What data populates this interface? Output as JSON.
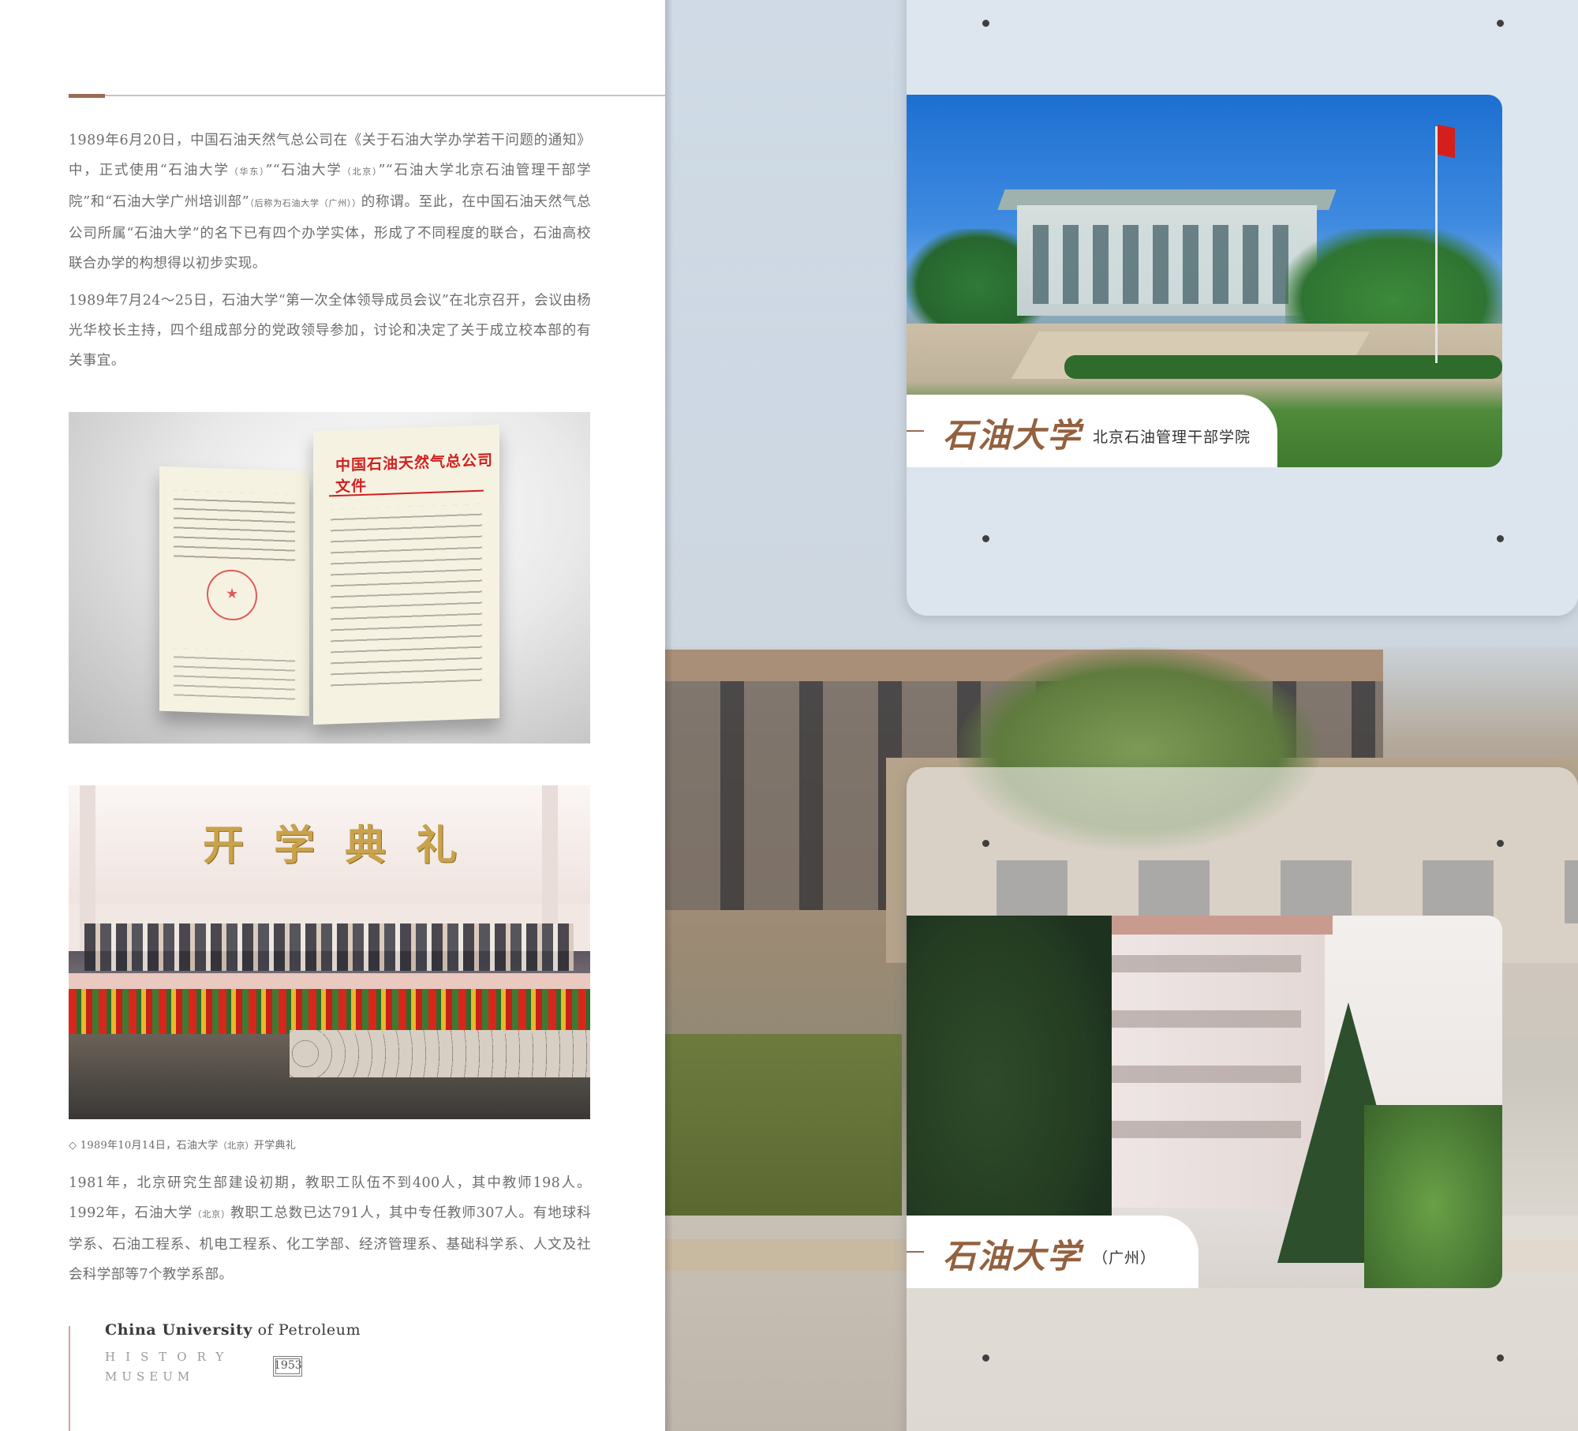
{
  "left_page": {
    "paragraph_1": {
      "text_a": "1989年6月20日，中国石油天然气总公司在《关于石油大学办学若干问题的通知》中，正式使用“石油大学",
      "small_a": "（华东）",
      "text_b": "”“石油大学",
      "small_b": "（北京）",
      "text_c": "”“石油大学北京石油管理干部学院”和“石油大学广州培训部”",
      "small_c": "（后称为石油大学（广州））",
      "text_d": "的称谓。至此，在中国石油天然气总公司所属“石油大学”的名下已有四个办学实体，形成了不同程度的联合，石油高校联合办学的构想得以初步实现。"
    },
    "paragraph_2": "1989年7月24～25日，石油大学“第一次全体领导成员会议”在北京召开，会议由杨光华校长主持，四个组成部分的党政领导参加，讨论和决定了关于成立校本部的有关事宜。",
    "document_photo": {
      "heading": "中国石油天然气总公司文件"
    },
    "ceremony_photo": {
      "banner": "开学典礼"
    },
    "caption": {
      "marker": "◇",
      "text_a": "1989年10月14日，石油大学",
      "small": "（北京）",
      "text_b": "开学典礼"
    },
    "paragraph_3": {
      "text_a": "1981年，北京研究生部建设初期，教职工队伍不到400人，其中教师198人。1992年，石油大学",
      "small": "（北京）",
      "text_b": "教职工总数已达791人，其中专任教师307人。有地球科学系、石油工程系、机电工程系、化工学部、经济管理系、基础科学系、人文及社会科学部等7个教学系部。"
    },
    "footer": {
      "title_bold": "China University",
      "title_of": "of",
      "title_rest": "Petroleum",
      "history": "HISTORY",
      "museum": "MUSEUM",
      "year": "1953"
    }
  },
  "right_page": {
    "card_1": {
      "brand": "石油大学",
      "label": "北京石油管理干部学院"
    },
    "card_2": {
      "brand": "石油大学",
      "label": "（广州）"
    }
  },
  "colors": {
    "accent_brown": "#9c6b55",
    "brand_calligraphy": "#93613f",
    "document_red": "#d21f1f"
  }
}
